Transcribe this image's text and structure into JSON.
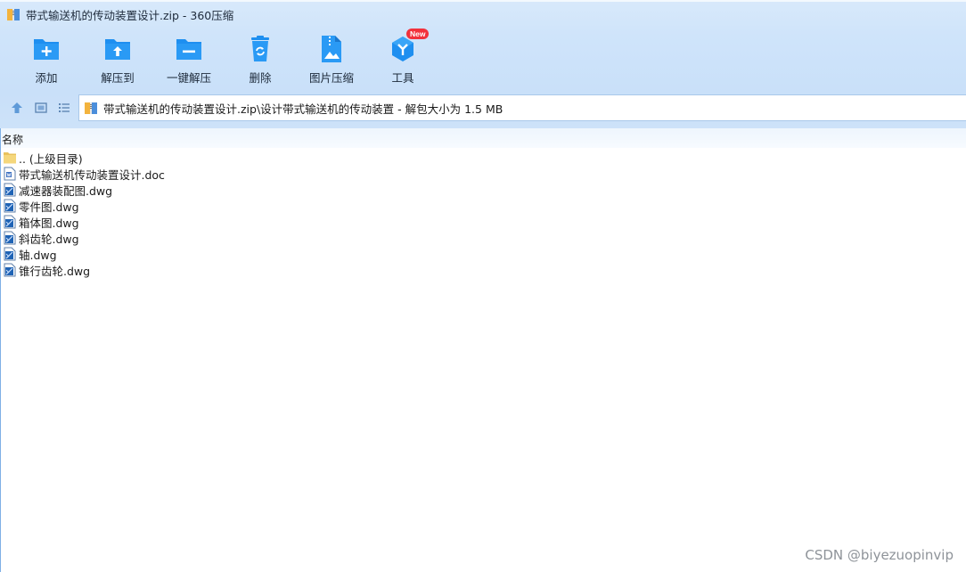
{
  "window": {
    "title": "带式输送机的传动装置设计.zip - 360压缩"
  },
  "toolbar": {
    "items": [
      {
        "label": "添加",
        "icon": "add-folder-icon"
      },
      {
        "label": "解压到",
        "icon": "extract-to-icon"
      },
      {
        "label": "一键解压",
        "icon": "one-click-extract-icon"
      },
      {
        "label": "删除",
        "icon": "recycle-bin-icon"
      },
      {
        "label": "图片压缩",
        "icon": "image-compress-icon"
      },
      {
        "label": "工具",
        "icon": "tools-icon",
        "badge": "New"
      }
    ]
  },
  "address_bar": {
    "path": "带式输送机的传动装置设计.zip\\设计带式输送机的传动装置 - 解包大小为 1.5 MB"
  },
  "file_list": {
    "column_name": "名称",
    "files": [
      {
        "name": ".. (上级目录)",
        "icon": "folder-icon"
      },
      {
        "name": "带式输送机传动装置设计.doc",
        "icon": "doc-file-icon"
      },
      {
        "name": "减速器装配图.dwg",
        "icon": "dwg-file-icon"
      },
      {
        "name": "零件图.dwg",
        "icon": "dwg-file-icon"
      },
      {
        "name": "箱体图.dwg",
        "icon": "dwg-file-icon"
      },
      {
        "name": "斜齿轮.dwg",
        "icon": "dwg-file-icon"
      },
      {
        "name": "轴.dwg",
        "icon": "dwg-file-icon"
      },
      {
        "name": "锥行齿轮.dwg",
        "icon": "dwg-file-icon"
      }
    ]
  },
  "watermark": "CSDN @biyezuopinvip",
  "colors": {
    "accent": "#1e8ff0",
    "chrome_bg": "#cfe4fa",
    "badge": "#f2313b"
  }
}
